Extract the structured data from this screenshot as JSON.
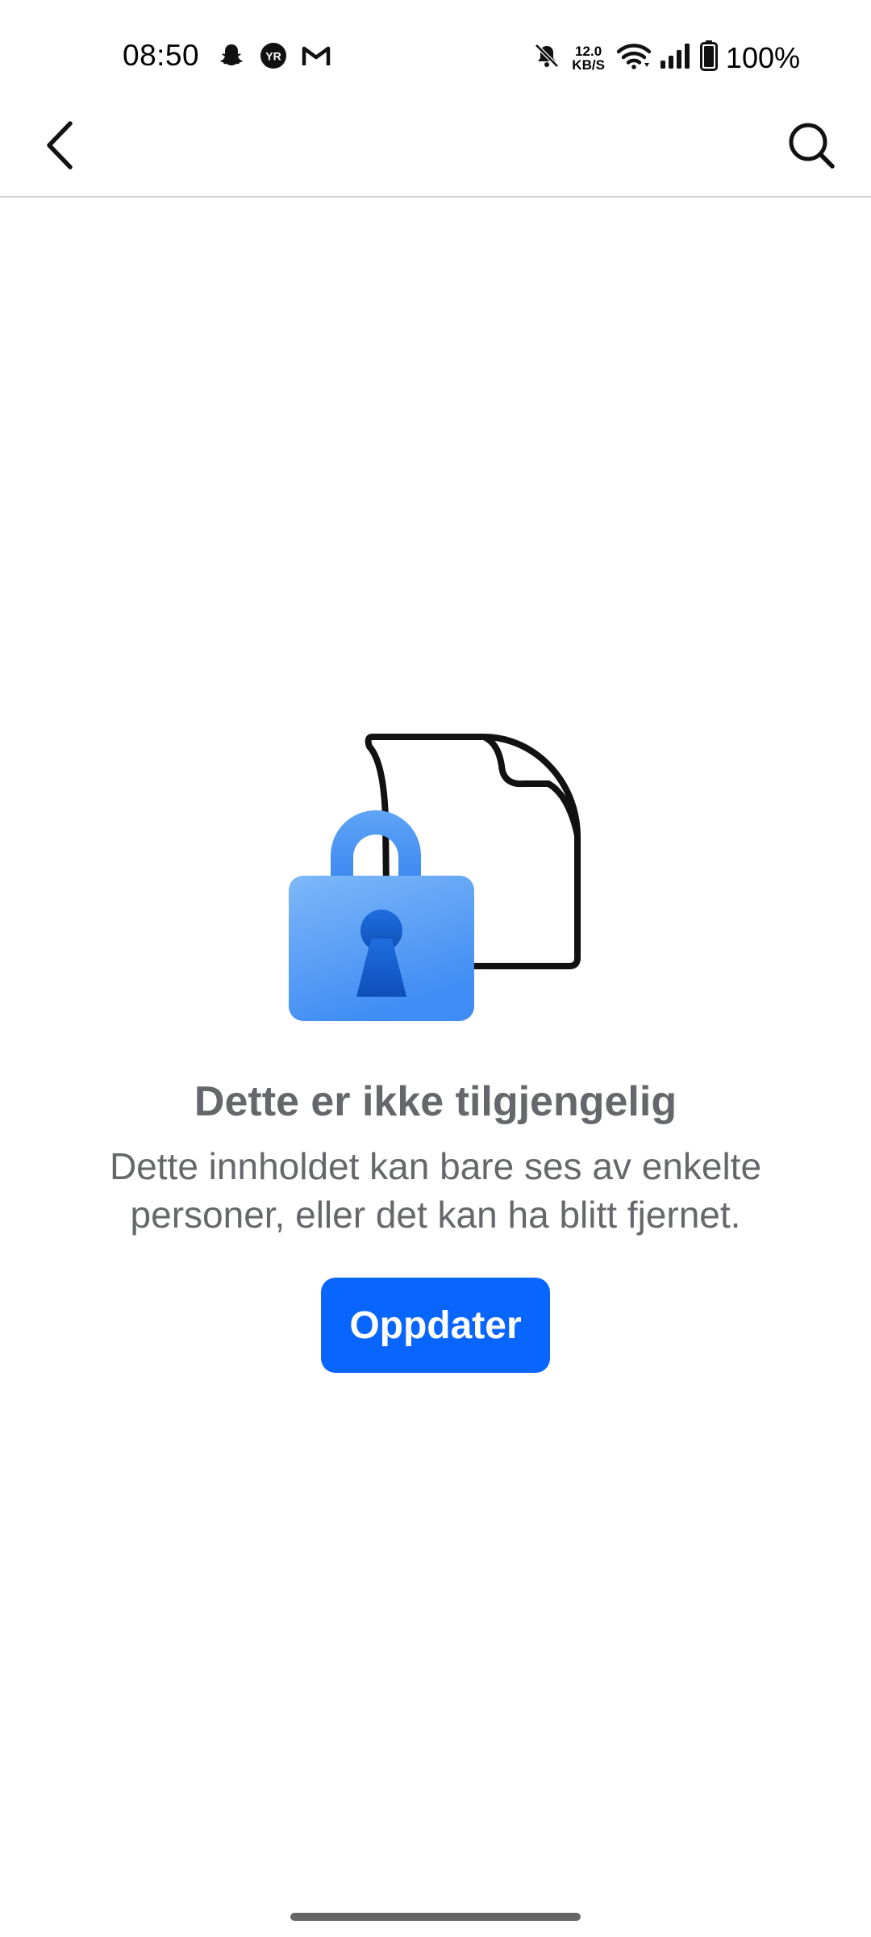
{
  "status_bar": {
    "time": "08:50",
    "notification_icons": [
      "snapchat-icon",
      "yr-icon",
      "gmail-icon"
    ],
    "yr_label": "YR",
    "net_speed_value": "12.0",
    "net_speed_unit": "KB/S",
    "battery": "100%"
  },
  "app_bar": {
    "back_icon": "chevron-left-icon",
    "search_icon": "search-icon"
  },
  "empty_state": {
    "illustration": "locked-document-icon",
    "title": "Dette er ikke tilgjengelig",
    "message_line1": "Dette innholdet kan bare ses av enkelte",
    "message_line2": "personer, eller det kan ha blitt fjernet.",
    "button_label": "Oppdater"
  },
  "colors": {
    "accent": "#0866ff",
    "text_secondary": "#65676b",
    "lock_light": "#6fb0f8",
    "lock_dark": "#1a5fd6"
  }
}
